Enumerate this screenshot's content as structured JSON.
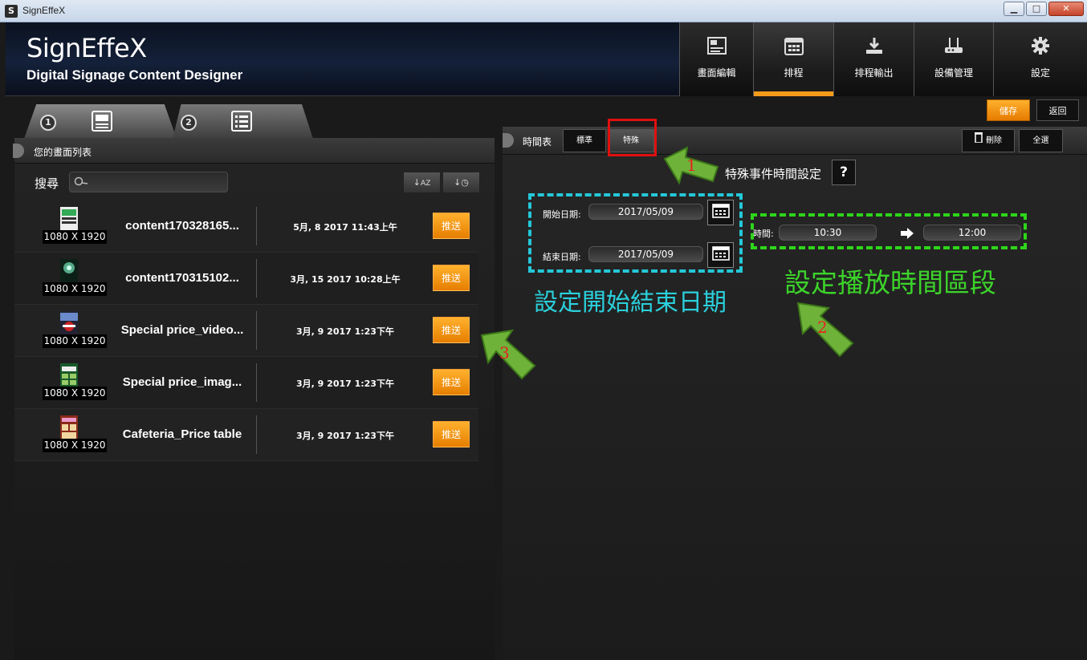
{
  "window": {
    "title": "SignEffeX",
    "app_icon": "S",
    "controls": [
      "minimize",
      "maximize",
      "close"
    ]
  },
  "header": {
    "logo": "SignEffeX",
    "tagline": "Digital Signage Content Designer",
    "nav": [
      {
        "label": "畫面編輯",
        "icon": "screen-edit-icon"
      },
      {
        "label": "排程",
        "icon": "calendar-icon",
        "active": true
      },
      {
        "label": "排程輸出",
        "icon": "download-icon"
      },
      {
        "label": "設備管理",
        "icon": "router-icon"
      },
      {
        "label": "設定",
        "icon": "gear-icon"
      }
    ],
    "accent_color": "#f29a1a"
  },
  "left": {
    "tabs": [
      {
        "num": "1",
        "icon": "image-list-icon"
      },
      {
        "num": "2",
        "icon": "list-icon"
      }
    ],
    "panel_title": "您的畫面列表",
    "search_label": "搜尋",
    "search_value": "",
    "sort_buttons": [
      "sort-alpha-icon",
      "sort-time-icon"
    ],
    "items": [
      {
        "name": "content170328165...",
        "resolution": "1080 X 1920",
        "date": "5月, 8 2017 11:43上午",
        "push": "推送"
      },
      {
        "name": "content170315102...",
        "resolution": "1080 X 1920",
        "date": "3月, 15 2017 10:28上午",
        "push": "推送"
      },
      {
        "name": "Special price_video...",
        "resolution": "1080 X 1920",
        "date": "3月, 9 2017 1:23下午",
        "push": "推送"
      },
      {
        "name": "Special price_imag...",
        "resolution": "1080 X 1920",
        "date": "3月, 9 2017 1:23下午",
        "push": "推送"
      },
      {
        "name": "Cafeteria_Price table",
        "resolution": "1080 X 1920",
        "date": "3月, 9 2017 1:23下午",
        "push": "推送"
      }
    ]
  },
  "right": {
    "save": "儲存",
    "back": "返回",
    "panel_title": "時間表",
    "tab_standard": "標準",
    "tab_special": "特殊",
    "delete": "刪除",
    "select_all": "全選",
    "event_title": "特殊事件時間設定",
    "help": "?",
    "start_label": "開始日期:",
    "start_value": "2017/05/09",
    "end_label": "結束日期:",
    "end_value": "2017/05/09",
    "time_label": "時間:",
    "time_from": "10:30",
    "time_to": "12:00"
  },
  "annotations": {
    "date_note": "設定開始結束日期",
    "time_note": "設定播放時間區段",
    "arrow1": "1",
    "arrow2": "2",
    "arrow3": "3",
    "colors": {
      "red": "#e01010",
      "cyan": "#24c8d8",
      "green": "#2ed61a"
    }
  }
}
